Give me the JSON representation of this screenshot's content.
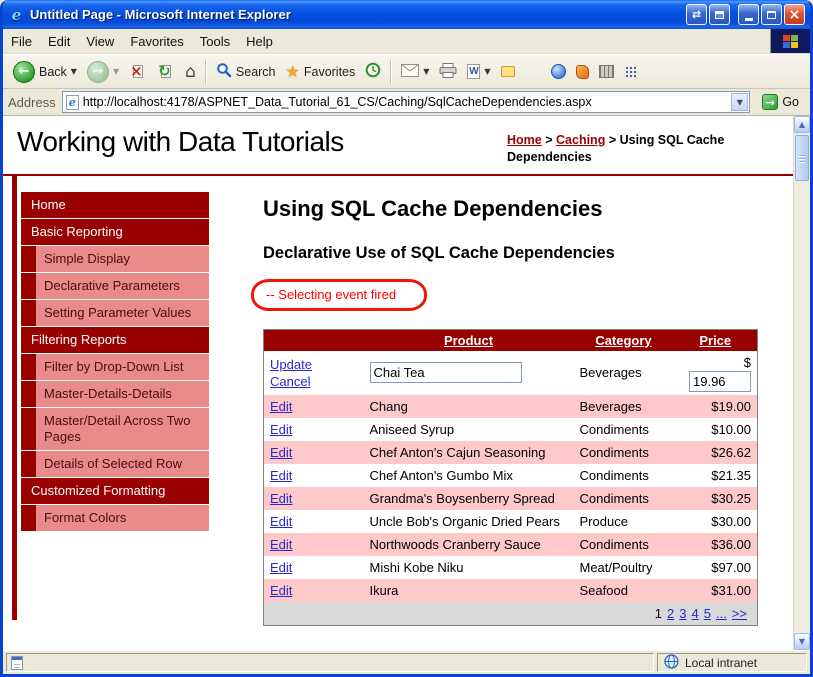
{
  "window": {
    "title": "Untitled Page - Microsoft Internet Explorer",
    "status": {
      "zone": "Local intranet"
    }
  },
  "menubar": {
    "items": [
      "File",
      "Edit",
      "View",
      "Favorites",
      "Tools",
      "Help"
    ]
  },
  "toolbar": {
    "back_label": "Back",
    "search_label": "Search",
    "favorites_label": "Favorites"
  },
  "addressbar": {
    "label": "Address",
    "url": "http://localhost:4178/ASPNET_Data_Tutorial_61_CS/Caching/SqlCacheDependencies.aspx",
    "go_label": "Go"
  },
  "page": {
    "site_title": "Working with Data Tutorials",
    "breadcrumb": {
      "home": "Home",
      "sep1": ">",
      "section": "Caching",
      "sep2": ">",
      "current": "Using SQL Cache Dependencies"
    },
    "heading": "Using SQL Cache Dependencies",
    "subheading": "Declarative Use of SQL Cache Dependencies",
    "event_message": "-- Selecting event fired"
  },
  "sidebar": {
    "items": [
      {
        "label": "Home",
        "type": "section"
      },
      {
        "label": "Basic Reporting",
        "type": "section"
      },
      {
        "label": "Simple Display",
        "type": "item"
      },
      {
        "label": "Declarative Parameters",
        "type": "item"
      },
      {
        "label": "Setting Parameter Values",
        "type": "item"
      },
      {
        "label": "Filtering Reports",
        "type": "section"
      },
      {
        "label": "Filter by Drop-Down List",
        "type": "item"
      },
      {
        "label": "Master-Details-Details",
        "type": "item"
      },
      {
        "label": "Master/Detail Across Two Pages",
        "type": "item"
      },
      {
        "label": "Details of Selected Row",
        "type": "item"
      },
      {
        "label": "Customized Formatting",
        "type": "section"
      },
      {
        "label": "Format Colors",
        "type": "item"
      }
    ]
  },
  "grid": {
    "headers": {
      "product": "Product",
      "category": "Category",
      "price": "Price"
    },
    "edit_row": {
      "update_label": "Update",
      "cancel_label": "Cancel",
      "product_value": "Chai Tea",
      "category": "Beverages",
      "currency": "$",
      "price_value": "19.96"
    },
    "rows": [
      {
        "action": "Edit",
        "product": "Chang",
        "category": "Beverages",
        "price": "$19.00"
      },
      {
        "action": "Edit",
        "product": "Aniseed Syrup",
        "category": "Condiments",
        "price": "$10.00"
      },
      {
        "action": "Edit",
        "product": "Chef Anton's Cajun Seasoning",
        "category": "Condiments",
        "price": "$26.62"
      },
      {
        "action": "Edit",
        "product": "Chef Anton's Gumbo Mix",
        "category": "Condiments",
        "price": "$21.35"
      },
      {
        "action": "Edit",
        "product": "Grandma's Boysenberry Spread",
        "category": "Condiments",
        "price": "$30.25"
      },
      {
        "action": "Edit",
        "product": "Uncle Bob's Organic Dried Pears",
        "category": "Produce",
        "price": "$30.00"
      },
      {
        "action": "Edit",
        "product": "Northwoods Cranberry Sauce",
        "category": "Condiments",
        "price": "$36.00"
      },
      {
        "action": "Edit",
        "product": "Mishi Kobe Niku",
        "category": "Meat/Poultry",
        "price": "$97.00"
      },
      {
        "action": "Edit",
        "product": "Ikura",
        "category": "Seafood",
        "price": "$31.00"
      }
    ],
    "pager": {
      "current": "1",
      "links": [
        "2",
        "3",
        "4",
        "5",
        "...",
        ">>"
      ]
    }
  },
  "glyphs": {
    "ie": "e",
    "close": "×",
    "swap": "⇄",
    "back": "←",
    "forward": "→",
    "stop": "×",
    "refresh": "↻",
    "home": "⌂",
    "star": "★",
    "caret": "▼",
    "up": "▲",
    "down": "▼",
    "go": "→",
    "word": "W"
  },
  "colors": {
    "maroon": "#990000",
    "sidebar_pink": "#E98B8B",
    "row_pink": "#FFC9C9",
    "pager_gray": "#D9D9D9",
    "link_blue": "#2828CC",
    "annotation_red": "#F2150A"
  }
}
